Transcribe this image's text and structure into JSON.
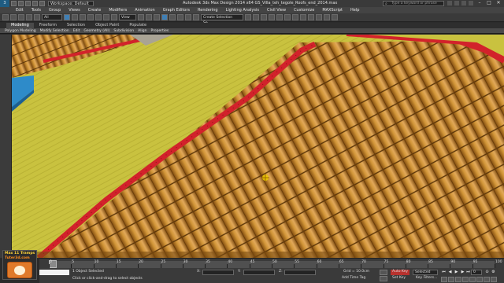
{
  "titlebar": {
    "logo_text": "3",
    "workspace": "Workspace: Default",
    "title": "Autodesk 3ds Max Design 2014 x64     GS_Villa_teh_tegole_Roofs_end_2014.max",
    "search_placeholder": "Type a keyword or phrase",
    "window_buttons": [
      "–",
      "□",
      "✕"
    ]
  },
  "menu": [
    "Edit",
    "Tools",
    "Group",
    "Views",
    "Create",
    "Modifiers",
    "Animation",
    "Graph Editors",
    "Rendering",
    "Lighting Analysis",
    "Civil View",
    "Customize",
    "MAXScript",
    "Help"
  ],
  "toolbar": {
    "selection_filter": "All",
    "ref_coord": "View",
    "named_sel": "Create Selection Se..."
  },
  "ribbon": {
    "tabs": [
      "Modeling",
      "Freeform",
      "Selection",
      "Object Paint",
      "Populate"
    ],
    "active_tab": "Modeling",
    "subpanels": [
      "Polygon Modeling",
      "Modify Selection",
      "Edit",
      "Geometry (All)",
      "Subdivision",
      "Align",
      "Properties"
    ]
  },
  "badge": {
    "line1": "Max 11 Tramps",
    "line2": "Tuter3d.com"
  },
  "timeline": {
    "labels": [
      "0",
      "5",
      "10",
      "15",
      "20",
      "25",
      "30",
      "35",
      "40",
      "45",
      "50",
      "55",
      "60",
      "65",
      "70",
      "75",
      "80",
      "85",
      "90",
      "95",
      "100"
    ],
    "current_frame": 0
  },
  "status": {
    "selection": "1 Object Selected",
    "prompt": "Click or click-and-drag to select objects",
    "x_label": "X:",
    "y_label": "Y:",
    "z_label": "Z:",
    "grid": "Grid = 10.0cm",
    "add_time_tag": "Add Time Tag",
    "auto_key": "Auto Key",
    "selected": "Selected",
    "set_key": "Set Key",
    "key_filters": "Key Filters...",
    "frame": "0"
  },
  "colors": {
    "roof_tile": "#cf8f2c",
    "ridge_red": "#d2222b",
    "viewport_ground": "#c7c040",
    "water_blue": "#2e8bc9"
  }
}
